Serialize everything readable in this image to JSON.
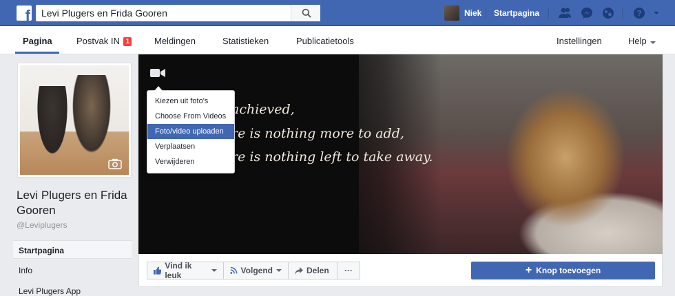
{
  "topbar": {
    "logo": "f",
    "search_value": "Levi Plugers en Frida Gooren",
    "user_name": "Niek",
    "home_link": "Startpagina",
    "icons": [
      "friends-icon",
      "messenger-icon",
      "notifications-icon",
      "help-icon"
    ],
    "colors": {
      "bar": "#4267b2",
      "notification_badge": "#fa3e3e"
    }
  },
  "page_nav": {
    "tabs": [
      {
        "label": "Pagina"
      },
      {
        "label": "Postvak IN",
        "badge": "1"
      },
      {
        "label": "Meldingen"
      },
      {
        "label": "Statistieken"
      },
      {
        "label": "Publicatietools"
      }
    ],
    "settings": "Instellingen",
    "help": "Help"
  },
  "page": {
    "name": "Levi Plugers en Frida Gooren",
    "handle": "@Leviplugers",
    "nav": [
      {
        "label": "Startpagina"
      },
      {
        "label": "Info"
      },
      {
        "label": "Levi Plugers App"
      }
    ]
  },
  "cover": {
    "quote_lines": [
      "achieved,",
      "re is nothing more to add,",
      "re is nothing left to take away."
    ],
    "menu": [
      {
        "label": "Kiezen uit foto's"
      },
      {
        "label": "Choose From Videos"
      },
      {
        "label": "Foto/video uploaden"
      },
      {
        "label": "Verplaatsen"
      },
      {
        "label": "Verwijderen"
      }
    ]
  },
  "actions": {
    "like": "Vind ik leuk",
    "follow": "Volgend",
    "share": "Delen",
    "more": "···",
    "add_button": "Knop toevoegen",
    "add_plus": "+"
  }
}
